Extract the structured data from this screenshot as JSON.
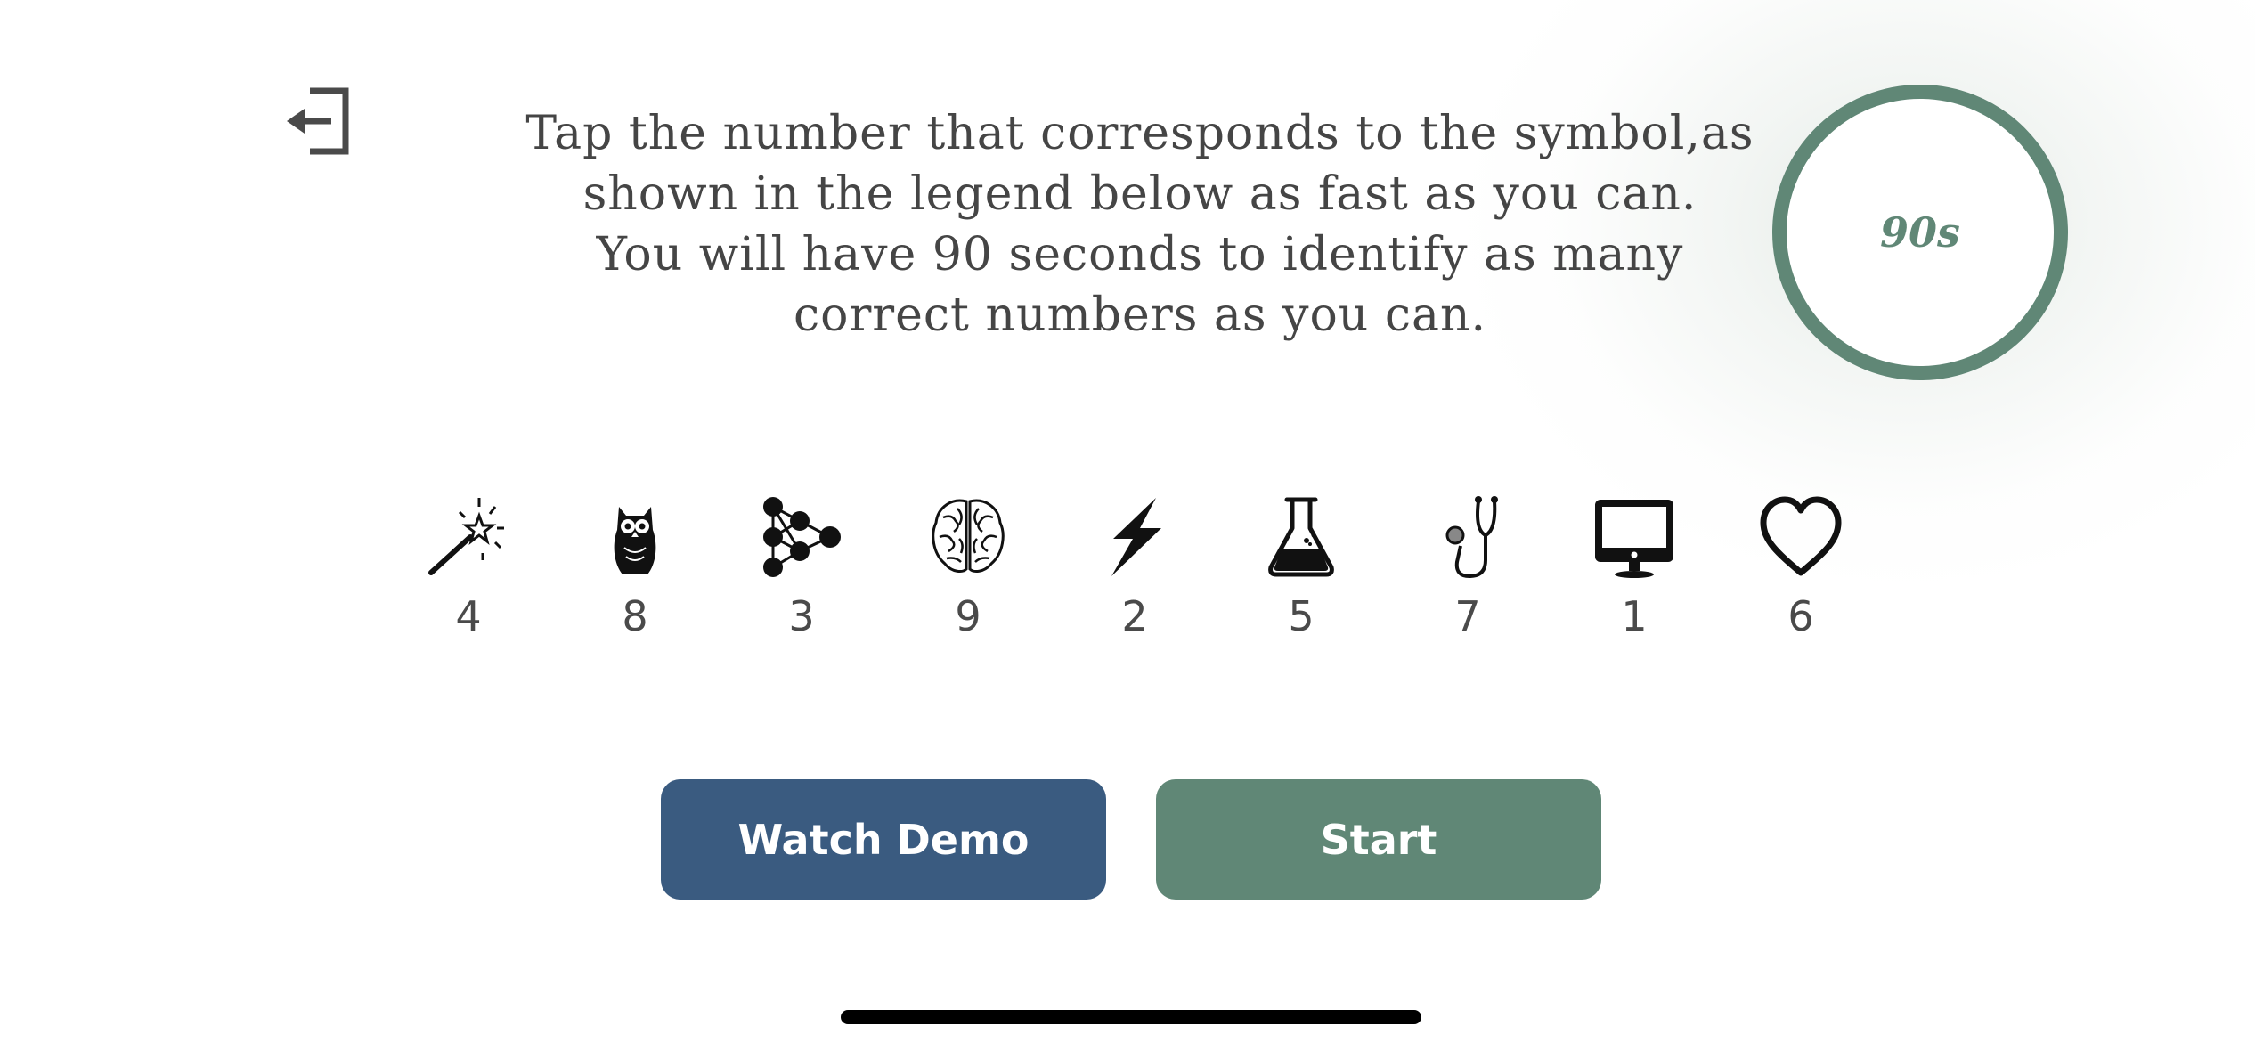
{
  "header": {
    "exit_icon": "exit-arrow-icon"
  },
  "instructions": {
    "lines": [
      "Tap the number that corresponds to the symbol,as",
      "shown in the legend below as fast as you can.",
      "You will have 90 seconds to identify as many",
      "correct numbers as you can."
    ]
  },
  "timer": {
    "label": "90s",
    "color": "#608776"
  },
  "legend": [
    {
      "icon": "magic-wand-icon",
      "number": "4"
    },
    {
      "icon": "owl-icon",
      "number": "8"
    },
    {
      "icon": "network-nodes-icon",
      "number": "3"
    },
    {
      "icon": "brain-icon",
      "number": "9"
    },
    {
      "icon": "lightning-bolt-icon",
      "number": "2"
    },
    {
      "icon": "flask-icon",
      "number": "5"
    },
    {
      "icon": "stethoscope-icon",
      "number": "7"
    },
    {
      "icon": "monitor-icon",
      "number": "1"
    },
    {
      "icon": "heart-icon",
      "number": "6"
    }
  ],
  "buttons": {
    "watch_demo": "Watch Demo",
    "start": "Start"
  },
  "colors": {
    "demo_button": "#3a5b80",
    "start_button": "#608776",
    "text": "#454545"
  }
}
